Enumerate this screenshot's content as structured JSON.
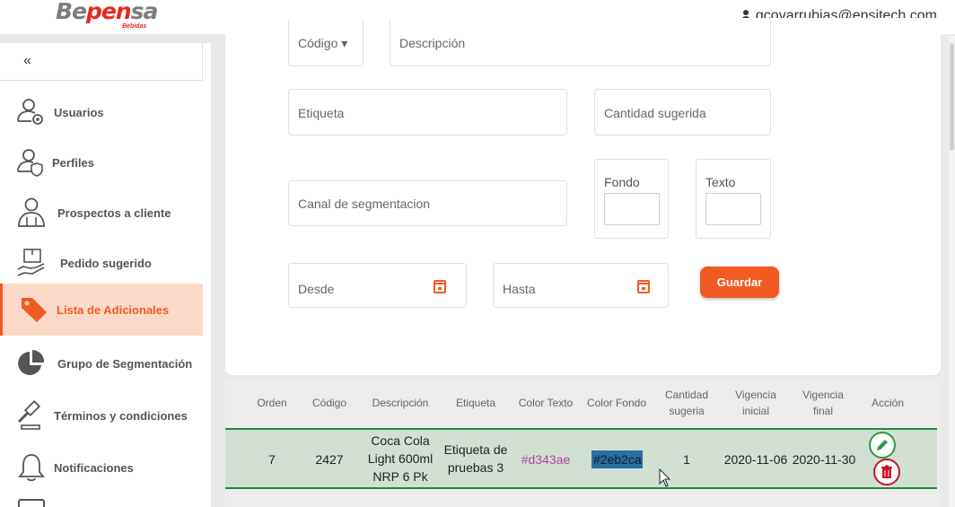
{
  "header": {
    "logo_text_part1": "Be",
    "logo_text_accent": "pen",
    "logo_text_part2": "sa",
    "logo_subtext": "Bebidas",
    "user_email": "gcovarrubias@ensitech.com"
  },
  "sidebar": {
    "collapse_label": "«",
    "items": [
      {
        "label": "Usuarios",
        "icon": "user-gear-icon",
        "active": false
      },
      {
        "label": "Perfiles",
        "icon": "user-shield-icon",
        "active": false
      },
      {
        "label": "Prospectos a cliente",
        "icon": "users-icon",
        "active": false
      },
      {
        "label": "Pedido sugerido",
        "icon": "box-hand-icon",
        "active": false
      },
      {
        "label": "Lista de Adicionales",
        "icon": "tag-icon",
        "active": true
      },
      {
        "label": "Grupo de Segmentación",
        "icon": "pie-chart-icon",
        "active": false
      },
      {
        "label": "Términos y condiciones",
        "icon": "gavel-icon",
        "active": false
      },
      {
        "label": "Notificaciones",
        "icon": "bell-icon",
        "active": false
      }
    ]
  },
  "form": {
    "codigo_label": "Código",
    "descripcion_placeholder": "Descripción",
    "etiqueta_placeholder": "Etiqueta",
    "cantidad_placeholder": "Cantidad sugerida",
    "canal_placeholder": "Canal de segmentacion",
    "fondo_label": "Fondo",
    "texto_label": "Texto",
    "desde_placeholder": "Desde",
    "hasta_placeholder": "Hasta",
    "save_label": "Guardar"
  },
  "table": {
    "headers": [
      "Orden",
      "Código",
      "Descripción",
      "Etiqueta",
      "Color Texto",
      "Color Fondo",
      "Cantidad sugeria",
      "Vigencia inicial",
      "Vigencia final",
      "Acción"
    ],
    "rows": [
      {
        "orden": "7",
        "codigo": "2427",
        "descripcion": "Coca Cola Light 600ml NRP 6 Pk",
        "etiqueta": "Etiqueta de pruebas 3",
        "color_texto": "#d343ae",
        "color_fondo": "#2eb2ca",
        "cantidad": "1",
        "vigencia_inicial": "2020-11-06",
        "vigencia_final": "2020-11-30"
      }
    ]
  },
  "colors": {
    "accent": "#f15a22",
    "row_border": "#1f8a3e",
    "edit": "#2e9a3e",
    "delete": "#c8102e"
  }
}
